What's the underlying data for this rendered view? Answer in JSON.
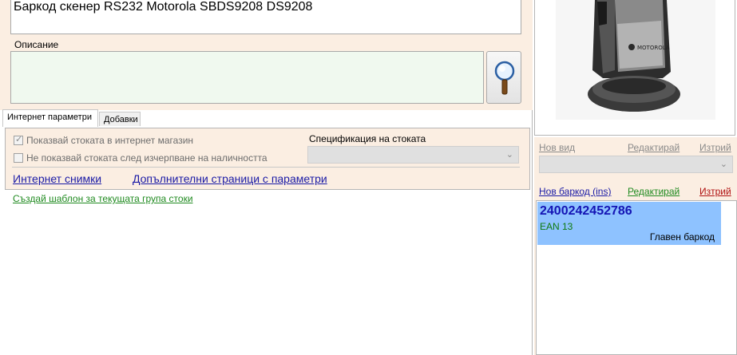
{
  "product": {
    "name": "Баркод скенер RS232 Motorola SBDS9208 DS9208",
    "description_label": "Описание",
    "description_value": ""
  },
  "tabs": [
    {
      "label": "Интернет параметри",
      "active": true
    },
    {
      "label": "Добавки",
      "active": false
    }
  ],
  "internet": {
    "show_in_shop_label": "Показвай стоката в интернет магазин",
    "show_in_shop_checked": true,
    "hide_when_out_label": "Не показвай стоката след изчерпване на наличността",
    "hide_when_out_checked": false,
    "spec_label": "Спецификация на стоката",
    "spec_value": "",
    "photos_link": "Интернет снимки",
    "extra_pages_link": "Допълнителни страници с параметри"
  },
  "template_link": "Създай шаблон за текущата група стоки",
  "views": {
    "new_label": "Нов вид",
    "edit_label": "Редактирай",
    "delete_label": "Изтрий",
    "selected": ""
  },
  "barcodes": {
    "new_label": "Нов баркод (ins)",
    "edit_label": "Редактирай",
    "delete_label": "Изтрий",
    "items": [
      {
        "value": "2400242452786",
        "type": "EAN 13",
        "note": "Главен баркод"
      }
    ]
  },
  "photo": {
    "brand_text": "MOTOROLA"
  },
  "colors": {
    "panel_bg": "#fbeee2",
    "link_blue": "#1a1aa6",
    "link_green": "#1f8a1f",
    "link_red": "#b01010",
    "selection": "#8ec2ff"
  }
}
